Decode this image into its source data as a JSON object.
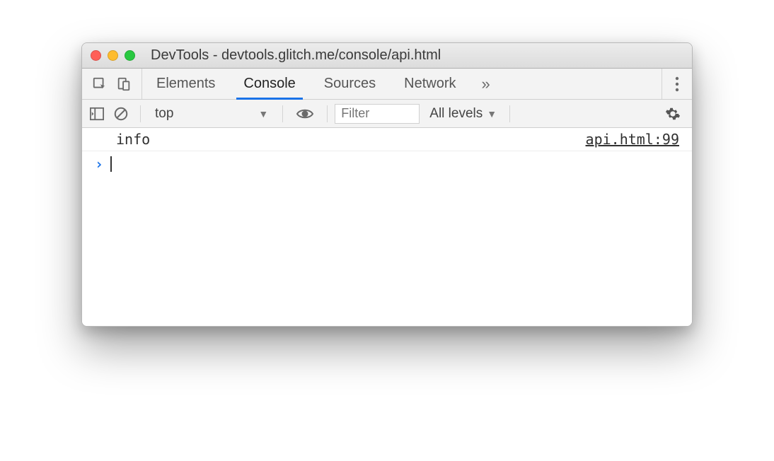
{
  "window": {
    "title": "DevTools - devtools.glitch.me/console/api.html"
  },
  "tabs": {
    "elements": "Elements",
    "console": "Console",
    "sources": "Sources",
    "network": "Network",
    "overflow": "»"
  },
  "toolbar": {
    "context": "top",
    "filter_placeholder": "Filter",
    "levels": "All levels"
  },
  "log": {
    "message": "info",
    "source": "api.html:99"
  }
}
